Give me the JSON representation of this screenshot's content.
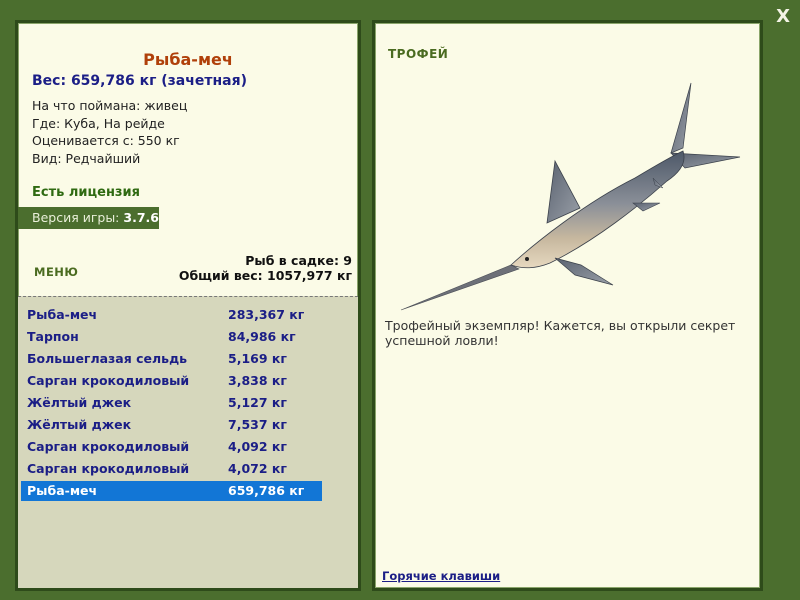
{
  "close_label": "X",
  "fish": {
    "name": "Рыба-меч",
    "weight_line": "Вес: 659,786 кг (зачетная)",
    "caught_on": "На что поймана: живец",
    "location": "Где: Куба, На рейде",
    "valued_from": "Оценивается с: 550 кг",
    "rarity": "Вид: Редчайший"
  },
  "license_text": "Есть лицензия",
  "version": {
    "label": "Версия игры: ",
    "value": "3.7.6"
  },
  "menu_label": "МЕНЮ",
  "stats": {
    "count_line": "Рыб в садке: 9",
    "total_line": "Общий вес: 1057,977 кг"
  },
  "catch_list": [
    {
      "name": "Рыба-меч",
      "weight": "283,367 кг"
    },
    {
      "name": "Тарпон",
      "weight": "84,986 кг"
    },
    {
      "name": "Большеглазая сельдь",
      "weight": "5,169 кг"
    },
    {
      "name": "Сарган крокодиловый",
      "weight": "3,838 кг"
    },
    {
      "name": "Жёлтый джек",
      "weight": "5,127 кг"
    },
    {
      "name": "Жёлтый джек",
      "weight": "7,537 кг"
    },
    {
      "name": "Сарган крокодиловый",
      "weight": "4,092 кг"
    },
    {
      "name": "Сарган крокодиловый",
      "weight": "4,072 кг"
    },
    {
      "name": "Рыба-меч",
      "weight": "659,786 кг"
    }
  ],
  "selected_index": 8,
  "trophy": {
    "label": "ТРОФЕЙ",
    "description": "Трофейный экземпляр! Кажется, вы открыли секрет успешной ловли!",
    "hotkeys_link": "Горячие клавиши",
    "image_icon": "swordfish-image"
  },
  "colors": {
    "frame_green": "#4b6e2e",
    "panel_bg": "#fbfbe7",
    "list_bg": "#d6d7bc",
    "selection_blue": "#1276d6",
    "title_orange": "#b0400a",
    "text_navy": "#1b1e86"
  }
}
